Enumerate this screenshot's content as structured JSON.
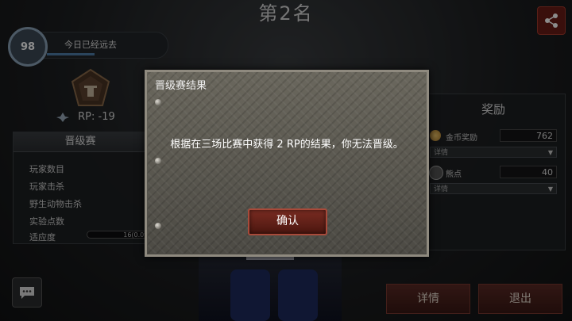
{
  "header": {
    "title": "第2名"
  },
  "player": {
    "level": "98",
    "status": "今日已经远去",
    "rp_label": "RP",
    "rp_value": ": -19"
  },
  "left_panel": {
    "title": "晋级赛",
    "rows": [
      "玩家数目",
      "玩家击杀",
      "野生动物击杀",
      "实验点数",
      "适应度"
    ],
    "fitness_progress": "16(0.0%)"
  },
  "right_panel": {
    "title": "奖励",
    "rewards": [
      {
        "name": "金币奖励",
        "value": "762",
        "detail": "详情"
      },
      {
        "name": "熊点",
        "value": "40",
        "detail": "详情"
      }
    ]
  },
  "dialog": {
    "title": "晋级赛结果",
    "message": "根据在三场比赛中获得 2 RP的结果，你无法晋级。",
    "confirm_label": "确认"
  },
  "bottom": {
    "details_label": "详情",
    "exit_label": "退出"
  },
  "icons": [
    "share-icon",
    "chat-icon",
    "rank-emblem-icon",
    "rp-icon",
    "coin-icon",
    "bear-points-icon",
    "chevron-down-icon"
  ]
}
